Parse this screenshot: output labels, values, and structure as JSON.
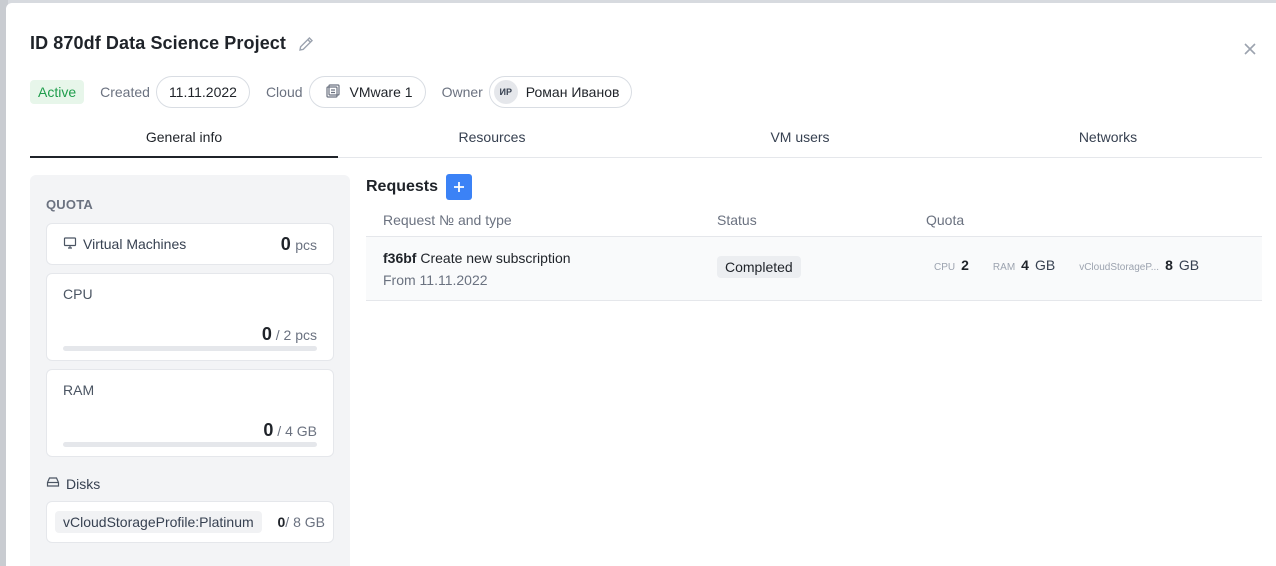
{
  "modal": {
    "title": "ID 870df Data Science Project"
  },
  "meta": {
    "status": "Active",
    "created_label": "Created",
    "created_value": "11.11.2022",
    "cloud_label": "Cloud",
    "cloud_value": "VMware 1",
    "owner_label": "Owner",
    "owner_initials": "ИР",
    "owner_name": "Роман Иванов"
  },
  "tabs": [
    {
      "label": "General info",
      "active": true
    },
    {
      "label": "Resources",
      "active": false
    },
    {
      "label": "VM users",
      "active": false
    },
    {
      "label": "Networks",
      "active": false
    }
  ],
  "quota": {
    "title": "QUOTA",
    "vm": {
      "label": "Virtual Machines",
      "value": "0",
      "unit": "pcs"
    },
    "cpu": {
      "label": "CPU",
      "used": "0",
      "total": "2",
      "unit": "pcs",
      "fraction": 0
    },
    "ram": {
      "label": "RAM",
      "used": "0",
      "total": "4",
      "unit": "GB",
      "fraction": 0
    },
    "disks": {
      "label": "Disks",
      "profile": "vCloudStorageProfile:Platinum",
      "used": "0",
      "total": "8",
      "unit": "GB"
    }
  },
  "requests": {
    "title": "Requests",
    "add_label": "+",
    "columns": [
      "Request № and type",
      "Status",
      "Quota"
    ],
    "rows": [
      {
        "id": "f36bf",
        "type": "Create new subscription",
        "from": "From 11.11.2022",
        "status": "Completed",
        "quota": {
          "cpu_label": "CPU",
          "cpu_value": "2",
          "ram_label": "RAM",
          "ram_value": "4",
          "ram_unit": "GB",
          "storage_label": "vCloudStorageP...",
          "storage_value": "8",
          "storage_unit": "GB"
        }
      }
    ]
  },
  "colors": {
    "accent": "#3b82f6",
    "active_green": "#1f9d4c"
  }
}
